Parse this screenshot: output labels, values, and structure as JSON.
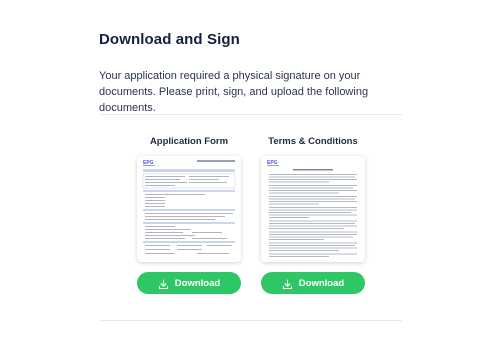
{
  "page": {
    "title": "Download and Sign",
    "description": "Your application required a physical signature on your documents. Please print, sign, and upload the following documents."
  },
  "documents": [
    {
      "title": "Application Form",
      "logo_text": "EPG",
      "button_label": "Download",
      "icon": "download-icon"
    },
    {
      "title": "Terms & Conditions",
      "logo_text": "EPG",
      "button_label": "Download",
      "icon": "download-icon"
    }
  ],
  "colors": {
    "button_green": "#2fc766",
    "title_navy": "#17213d",
    "logo_blue": "#4a5ad8",
    "form_header_blue": "#c9d6ee"
  }
}
